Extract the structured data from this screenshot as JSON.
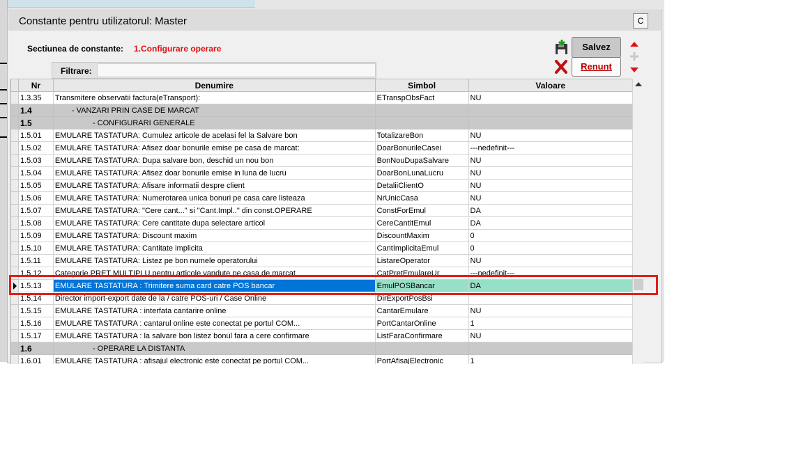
{
  "dialog": {
    "title": "Constante pentru utilizatorul: Master",
    "close_label": "C"
  },
  "section": {
    "label": "Sectiunea de constante:",
    "value": "1.Configurare operare"
  },
  "filter": {
    "label": "Filtrare:",
    "value": ""
  },
  "buttons": {
    "save_label": "Salvez",
    "cancel_label": "Renunt"
  },
  "table": {
    "headers": [
      "Nr",
      "Denumire",
      "Simbol",
      "Valoare"
    ],
    "rows": [
      {
        "nr": "1.3.35",
        "denumire": "Transmitere observatii factura(eTransport):",
        "simbol": "ETranspObsFact",
        "valoare": "NU"
      },
      {
        "nr": "1.4",
        "denumire": "- VANZARI PRIN CASE DE MARCAT",
        "simbol": "",
        "valoare": "",
        "group": true,
        "indent": 26
      },
      {
        "nr": "1.5",
        "denumire": "- CONFIGURARI GENERALE",
        "simbol": "",
        "valoare": "",
        "group": true,
        "indent": 56
      },
      {
        "nr": "1.5.01",
        "denumire": "EMULARE TASTATURA: Cumulez articole de acelasi fel la Salvare bon",
        "simbol": "TotalizareBon",
        "valoare": "NU"
      },
      {
        "nr": "1.5.02",
        "denumire": "EMULARE TASTATURA: Afisez doar bonurile emise pe casa de marcat:",
        "simbol": "DoarBonurileCasei",
        "valoare": "---nedefinit---"
      },
      {
        "nr": "1.5.03",
        "denumire": "EMULARE TASTATURA: Dupa salvare bon, deschid un nou bon",
        "simbol": "BonNouDupaSalvare",
        "valoare": "NU"
      },
      {
        "nr": "1.5.04",
        "denumire": "EMULARE TASTATURA: Afisez doar bonurile emise in luna de lucru",
        "simbol": "DoarBonLunaLucru",
        "valoare": "NU"
      },
      {
        "nr": "1.5.05",
        "denumire": "EMULARE TASTATURA: Afisare informatii despre client",
        "simbol": "DetaliiClientO",
        "valoare": "NU"
      },
      {
        "nr": "1.5.06",
        "denumire": "EMULARE TASTATURA: Numerotarea unica bonuri pe casa care listeaza",
        "simbol": "NrUnicCasa",
        "valoare": "NU"
      },
      {
        "nr": "1.5.07",
        "denumire": "EMULARE TASTATURA: \"Cere cant...\" si \"Cant.Impl..\" din const.OPERARE",
        "simbol": "ConstForEmul",
        "valoare": "DA"
      },
      {
        "nr": "1.5.08",
        "denumire": "EMULARE TASTATURA: Cere cantitate dupa selectare articol",
        "simbol": "CereCantitEmul",
        "valoare": "DA"
      },
      {
        "nr": "1.5.09",
        "denumire": "EMULARE TASTATURA: Discount maxim",
        "simbol": "DiscountMaxim",
        "valoare": "0"
      },
      {
        "nr": "1.5.10",
        "denumire": "EMULARE TASTATURA: Cantitate implicita",
        "simbol": "CantImplicitaEmul",
        "valoare": "0"
      },
      {
        "nr": "1.5.11",
        "denumire": "EMULARE TASTATURA: Listez pe bon numele operatorului",
        "simbol": "ListareOperator",
        "valoare": "NU"
      },
      {
        "nr": "1.5.12",
        "denumire": "Categorie PRET MULTIPLU pentru articole vandute pe casa de marcat",
        "simbol": "CatPretEmulareUr",
        "valoare": "---nedefinit---"
      },
      {
        "nr": "1.5.13",
        "denumire": "EMULARE TASTATURA : Trimitere suma card catre POS bancar",
        "simbol": "EmulPOSBancar",
        "valoare": "DA",
        "selected": true
      },
      {
        "nr": "1.5.14",
        "denumire": "Director import-export date de la / catre POS-uri / Case Online",
        "simbol": "DirExportPosBsi",
        "valoare": ""
      },
      {
        "nr": "1.5.15",
        "denumire": "EMULARE TASTATURA : interfata cantarire online",
        "simbol": "CantarEmulare",
        "valoare": "NU"
      },
      {
        "nr": "1.5.16",
        "denumire": "EMULARE TASTATURA : cantarul online este conectat pe portul COM...",
        "simbol": "PortCantarOnline",
        "valoare": "1"
      },
      {
        "nr": "1.5.17",
        "denumire": "EMULARE TASTATURA : la salvare bon listez bonul fara a cere confirmare",
        "simbol": "ListFaraConfirmare",
        "valoare": "NU"
      },
      {
        "nr": "1.6",
        "denumire": "- OPERARE LA DISTANTA",
        "simbol": "",
        "valoare": "",
        "group": true,
        "indent": 56
      },
      {
        "nr": "1.6.01",
        "denumire": "EMULARE TASTATURA : afisajul electronic este conectat pe portul COM...",
        "simbol": "PortAfisajElectronic",
        "valoare": "1"
      }
    ]
  },
  "colors": {
    "selected_row": "#0074d9",
    "selected_cells": "#96e0c8",
    "group_row": "#c9c9c9",
    "section_value": "#e01010",
    "highlight_box": "#e0201c"
  },
  "icons": {
    "save": "save-disk-icon",
    "cancel": "red-x-icon",
    "nav_up": "arrow-up-icon",
    "nav_plus": "plus-icon",
    "nav_down": "arrow-down-icon"
  }
}
